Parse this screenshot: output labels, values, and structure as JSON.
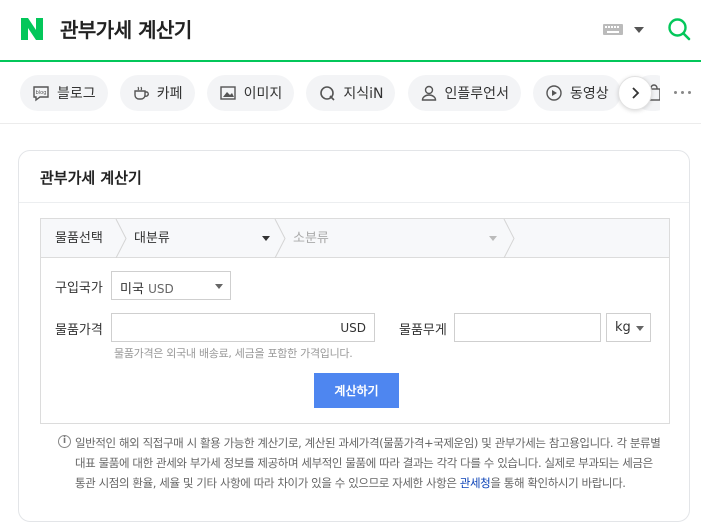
{
  "header": {
    "logo_letter": "N",
    "query": "관부가세 계산기",
    "brand_color": "#03c75a"
  },
  "tabs": [
    {
      "label": "블로그",
      "icon": "blog-icon"
    },
    {
      "label": "카페",
      "icon": "cafe-icon"
    },
    {
      "label": "이미지",
      "icon": "image-icon"
    },
    {
      "label": "지식iN",
      "icon": "kin-icon"
    },
    {
      "label": "인플루언서",
      "icon": "person-icon"
    },
    {
      "label": "동영상",
      "icon": "play-icon"
    }
  ],
  "card": {
    "title": "관부가세 계산기",
    "breadcrumb": {
      "first": "물품선택",
      "category": "대분류",
      "subcategory": "소분류"
    },
    "country": {
      "label": "구입국가",
      "value": "미국",
      "currency": "USD"
    },
    "price": {
      "label": "물품가격",
      "unit": "USD",
      "hint": "물품가격은 외국내 배송료, 세금을 포함한 가격입니다."
    },
    "weight": {
      "label": "물품무게",
      "unit": "kg"
    },
    "button_label": "계산하기",
    "accent_color": "#4e86f0"
  },
  "notice": {
    "icon_glyph": "i",
    "line1": "일반적인 해외 직접구매 시 활용 가능한 계산기로, 계산된 과세가격(물품가격+국제운임) 및 관부가세는 참고용입니다. 각 분류별 대표 물품에 대한 관세와 부가세 정보를 제공하며 세부적인 물품에 따라 결과는 각각 다를 수 있습니다. 실제로 부과되는 세금은 통관 시점의 환율, 세율 및 기타 사항에 따라 차이가 있을 수 있으므로 자세한 사항은 ",
    "link": "관세청",
    "line2": "을 통해 확인하시기 바랍니다."
  }
}
